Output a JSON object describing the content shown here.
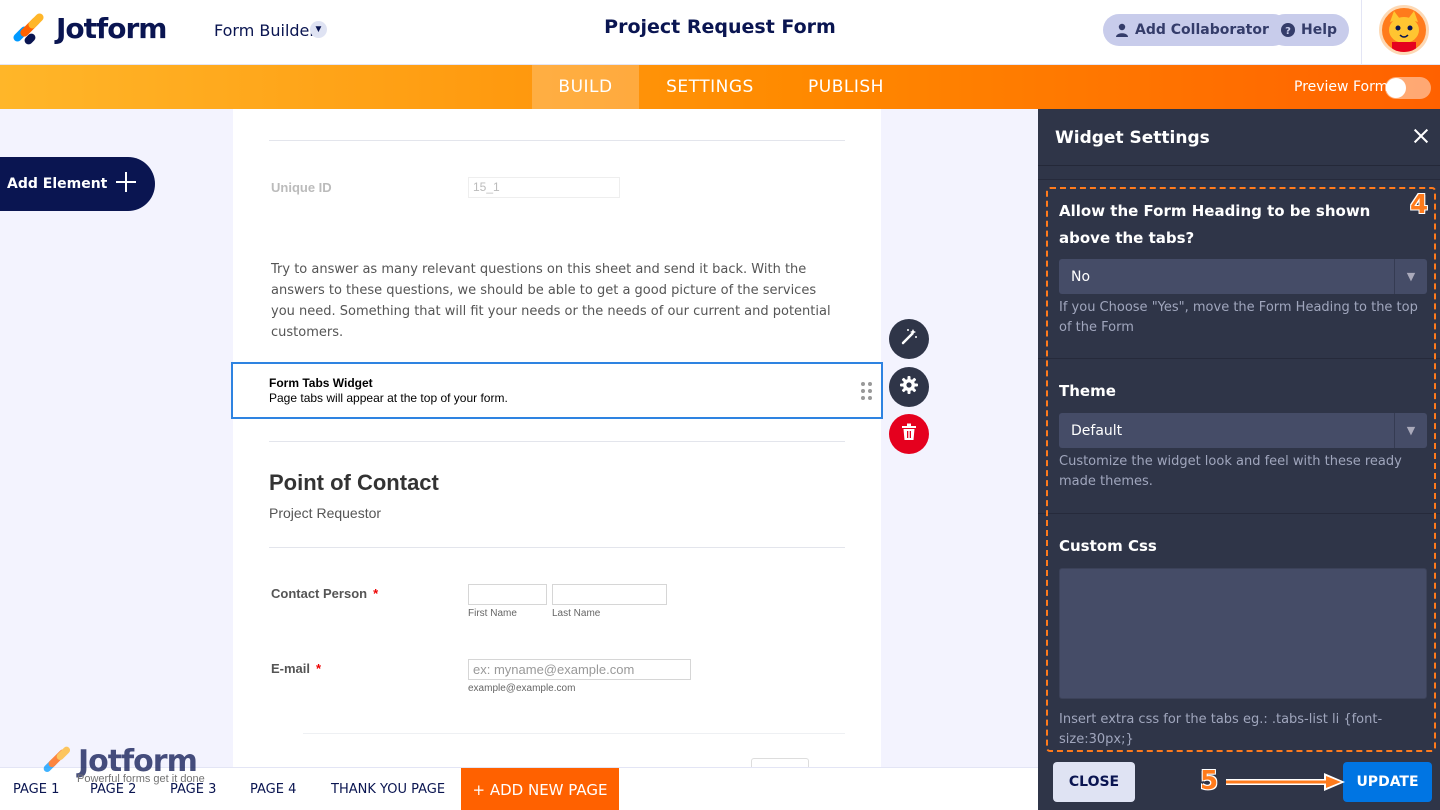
{
  "header": {
    "brand": "Jotform",
    "mode_label": "Form Builder",
    "form_title": "Project Request Form",
    "add_collaborators": "Add Collaborators",
    "help": "Help"
  },
  "nav": {
    "tabs": [
      {
        "label": "BUILD",
        "active": true
      },
      {
        "label": "SETTINGS",
        "active": false
      },
      {
        "label": "PUBLISH",
        "active": false
      }
    ],
    "preview_label": "Preview Form",
    "preview_on": false
  },
  "sidebar": {
    "add_element": "Add Element"
  },
  "form": {
    "unique_id_label": "Unique ID",
    "unique_id_value": "15_1",
    "intro_text": "Try to answer as many relevant questions on this sheet and send it back. With the answers to these questions, we should be able to get a good picture of the services you need. Something that will fit your needs or the needs of our current and potential customers.",
    "widget_title": "Form Tabs Widget",
    "widget_desc": "Page tabs will appear at the top of your form.",
    "section_title": "Point of Contact",
    "section_subtitle": "Project Requestor",
    "contact_label": "Contact Person",
    "required_mark": "*",
    "first_name_sub": "First Name",
    "last_name_sub": "Last Name",
    "email_label": "E-mail",
    "email_placeholder": "ex: myname@example.com",
    "email_sub": "example@example.com"
  },
  "pages": {
    "tabs": [
      "PAGE 1",
      "PAGE 2",
      "PAGE 3",
      "PAGE 4",
      "THANK YOU PAGE"
    ],
    "add_new": "+ ADD NEW PAGE"
  },
  "watermark": {
    "brand": "Jotform",
    "tagline": "Powerful forms get it done"
  },
  "panel": {
    "title": "Widget Settings",
    "q1_label": "Allow the Form Heading to be shown above the tabs?",
    "q1_value": "No",
    "q1_help": "If you Choose \"Yes\", move the Form Heading to the top of the Form",
    "theme_label": "Theme",
    "theme_value": "Default",
    "theme_help": "Customize the widget look and feel with these ready made themes.",
    "css_label": "Custom Css",
    "css_value": "",
    "css_help": "Insert extra css for the tabs eg.: .tabs-list li {font-size:30px;}",
    "close_btn": "CLOSE",
    "update_btn": "UPDATE"
  },
  "annotations": {
    "step4": "4",
    "step5": "5"
  },
  "colors": {
    "accent_orange": "#ff6100",
    "panel_bg": "#2f3548",
    "selected_border": "#2e83e1",
    "update_blue": "#0075e3",
    "delete_red": "#e5001e"
  }
}
